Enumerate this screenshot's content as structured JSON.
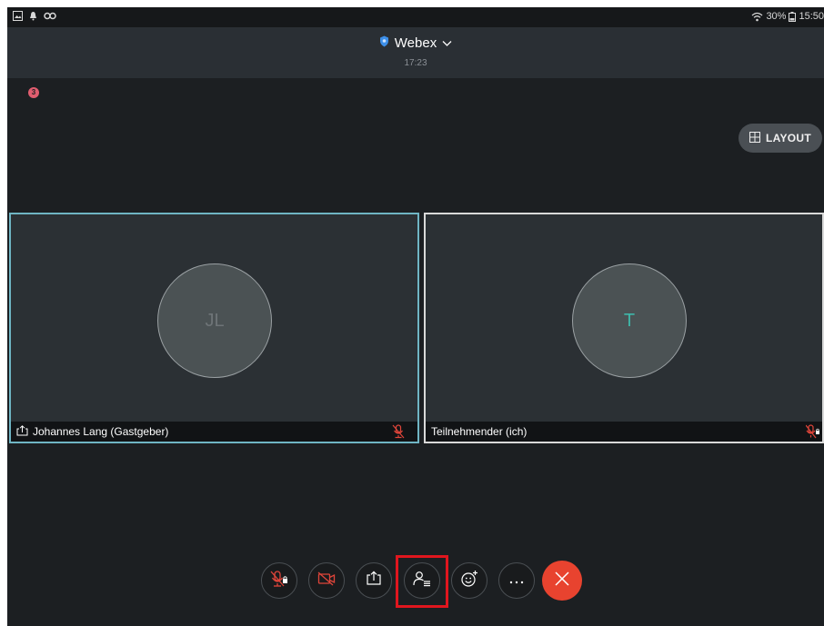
{
  "status_bar": {
    "left_icons": [
      "image-icon",
      "notification-icon",
      "app-icon"
    ],
    "battery": "30%",
    "time": "15:50"
  },
  "header": {
    "app_name": "Webex",
    "meeting_time": "17:23"
  },
  "recording_badge": "3",
  "layout_button": {
    "label": "LAYOUT"
  },
  "participants": [
    {
      "initials": "JL",
      "name": "Johannes Lang (Gastgeber)",
      "muted": true,
      "sharing": true,
      "initials_color": "#6e7477"
    },
    {
      "initials": "T",
      "name": "Teilnehmender (ich)",
      "muted": true,
      "sharing": false,
      "initials_color": "#3fb7a9"
    }
  ],
  "controls": [
    {
      "name": "mute-button",
      "icon": "mic-off-icon"
    },
    {
      "name": "video-button",
      "icon": "video-off-icon"
    },
    {
      "name": "share-button",
      "icon": "share-icon"
    },
    {
      "name": "participants-button",
      "icon": "participants-icon"
    },
    {
      "name": "reactions-button",
      "icon": "emoji-icon"
    },
    {
      "name": "more-button",
      "icon": "more-icon"
    },
    {
      "name": "leave-button",
      "icon": "close-icon"
    }
  ],
  "colors": {
    "accent_red": "#e8432f",
    "active_border": "#6fb5c4",
    "highlight_box": "#e0161e"
  }
}
